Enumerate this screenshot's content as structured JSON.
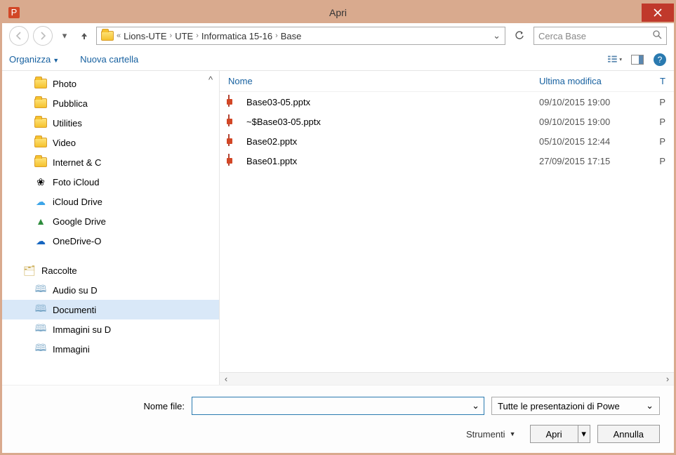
{
  "window": {
    "title": "Apri"
  },
  "nav": {
    "prefix": "«",
    "segments": [
      "Lions-UTE",
      "UTE",
      "Informatica 15-16",
      "Base"
    ],
    "search_placeholder": "Cerca Base"
  },
  "toolbar": {
    "organize": "Organizza",
    "new_folder": "Nuova cartella"
  },
  "tree": {
    "items": [
      {
        "label": "Photo",
        "icon": "folder"
      },
      {
        "label": "Pubblica",
        "icon": "folder"
      },
      {
        "label": "Utilities",
        "icon": "folder"
      },
      {
        "label": "Video",
        "icon": "folder"
      },
      {
        "label": "Internet & C",
        "icon": "folder"
      },
      {
        "label": "Foto iCloud",
        "icon": "icloud-photo"
      },
      {
        "label": "iCloud Drive",
        "icon": "icloud"
      },
      {
        "label": "Google Drive",
        "icon": "gdrive"
      },
      {
        "label": "OneDrive-O",
        "icon": "onedrive"
      }
    ],
    "library_label": "Raccolte",
    "libraries": [
      {
        "label": "Audio su D"
      },
      {
        "label": "Documenti",
        "selected": true
      },
      {
        "label": "Immagini su D"
      },
      {
        "label": "Immagini"
      }
    ]
  },
  "list": {
    "col_name": "Nome",
    "col_date": "Ultima modifica",
    "col_type": "T",
    "rows": [
      {
        "name": "Base03-05.pptx",
        "date": "09/10/2015 19:00",
        "type": "P"
      },
      {
        "name": "~$Base03-05.pptx",
        "date": "09/10/2015 19:00",
        "type": "P"
      },
      {
        "name": "Base02.pptx",
        "date": "05/10/2015 12:44",
        "type": "P"
      },
      {
        "name": "Base01.pptx",
        "date": "27/09/2015 17:15",
        "type": "P"
      }
    ]
  },
  "footer": {
    "filename_label": "Nome file:",
    "filename_value": "",
    "filter": "Tutte le presentazioni di Powe",
    "tools": "Strumenti",
    "open": "Apri",
    "cancel": "Annulla"
  }
}
